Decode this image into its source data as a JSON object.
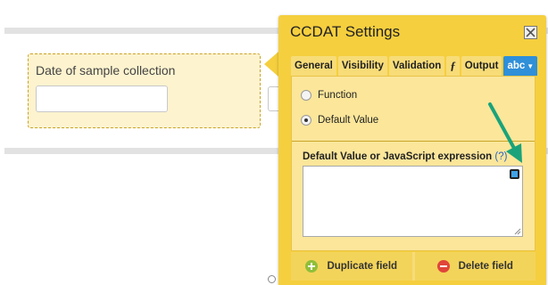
{
  "form": {
    "field_label": "Date of sample collection",
    "field_value": ""
  },
  "panel": {
    "title": "CCDAT Settings",
    "tabs": [
      {
        "label": "General"
      },
      {
        "label": "Visibility"
      },
      {
        "label": "Validation"
      },
      {
        "label": "ƒ"
      },
      {
        "label": "Output"
      },
      {
        "label": "abc",
        "active": true
      }
    ],
    "options": {
      "function_label": "Function",
      "default_value_label": "Default Value",
      "selected": "Default Value"
    },
    "default_value": {
      "label": "Default Value or JavaScript expression",
      "help": "(?)",
      "value": ""
    },
    "footer": {
      "duplicate_label": "Duplicate field",
      "delete_label": "Delete field"
    }
  },
  "colors": {
    "panel_bg": "#f5cf3e",
    "active_tab": "#2f8fd8",
    "annotation_arrow": "#1aa37a",
    "add_icon": "#8fbf3a",
    "delete_icon": "#e0453a"
  },
  "icons": {
    "close": "close-icon",
    "expand": "expand-editor-icon",
    "duplicate": "plus-circle-icon",
    "delete": "minus-circle-icon"
  }
}
